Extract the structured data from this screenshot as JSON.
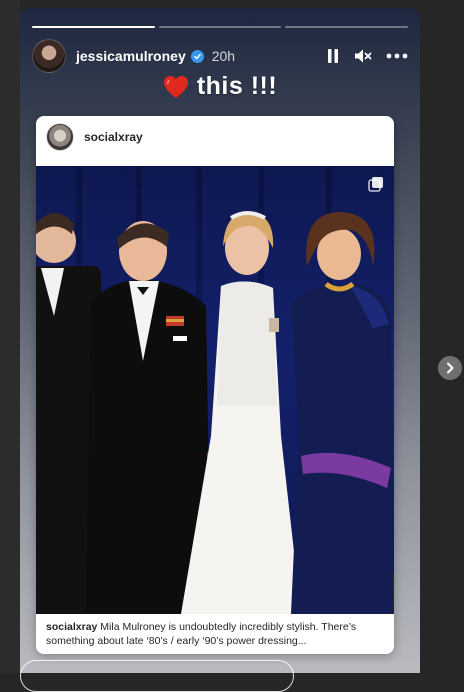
{
  "story": {
    "username": "jessicamulroney",
    "time": "20h",
    "progress": [
      1.0,
      0.0,
      0.0
    ],
    "sticker_text": "this !!!",
    "icons": {
      "avatar": "avatar",
      "verified": "verified-badge-icon",
      "pause": "pause-icon",
      "mute": "mute-icon",
      "more": "more-options-icon",
      "heart": "red-heart-icon",
      "next": "chevron-right-icon"
    }
  },
  "post": {
    "username": "socialxray",
    "caption_user": "socialxray",
    "caption_text": "Mila Mulroney is undoubtedly incredibly stylish. There’s something about late ‘80’s / early ‘90’s power dressing...",
    "image_icon": "multiple-images-icon"
  },
  "colors": {
    "verified": "#3897f0",
    "heart": "#e0291f",
    "curtain": "#14206b"
  }
}
